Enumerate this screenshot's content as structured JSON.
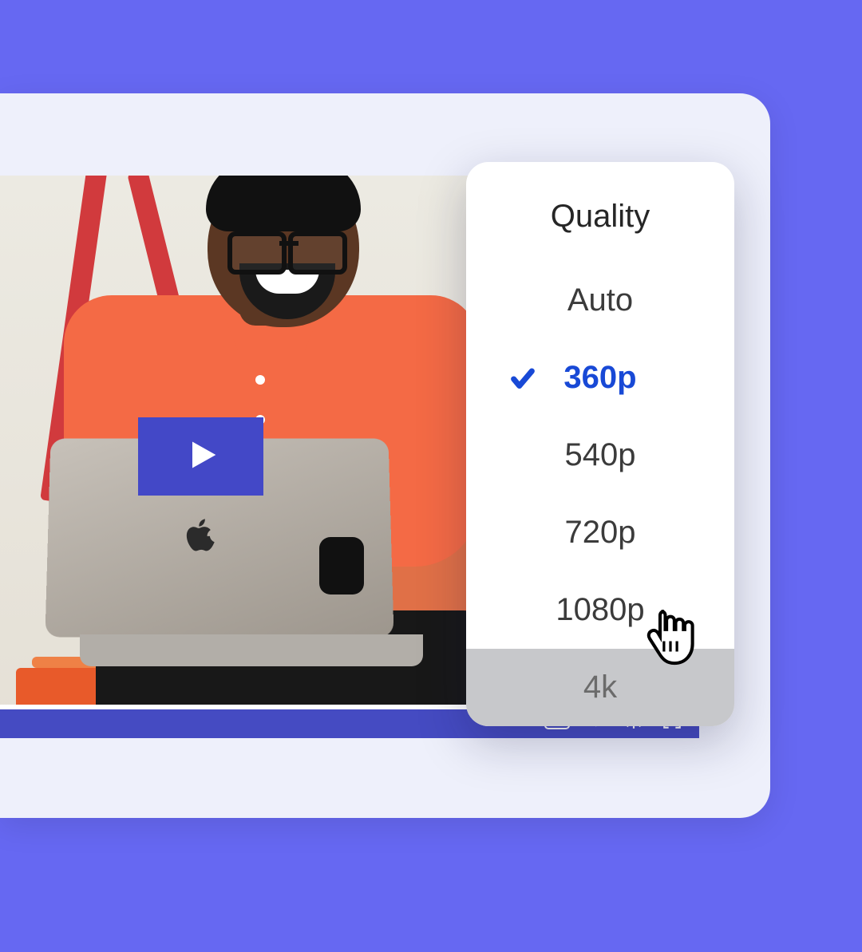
{
  "menu": {
    "title": "Quality",
    "options": [
      "Auto",
      "360p",
      "540p",
      "720p",
      "1080p",
      "4k"
    ],
    "selected": "360p",
    "hovered": "4k"
  },
  "controls": {
    "cc_label": "CC",
    "icons": {
      "captions": "cc-icon",
      "volume": "volume-icon",
      "settings": "gear-icon",
      "fullscreen": "fullscreen-icon"
    }
  },
  "play_button": {
    "icon": "play-icon"
  }
}
